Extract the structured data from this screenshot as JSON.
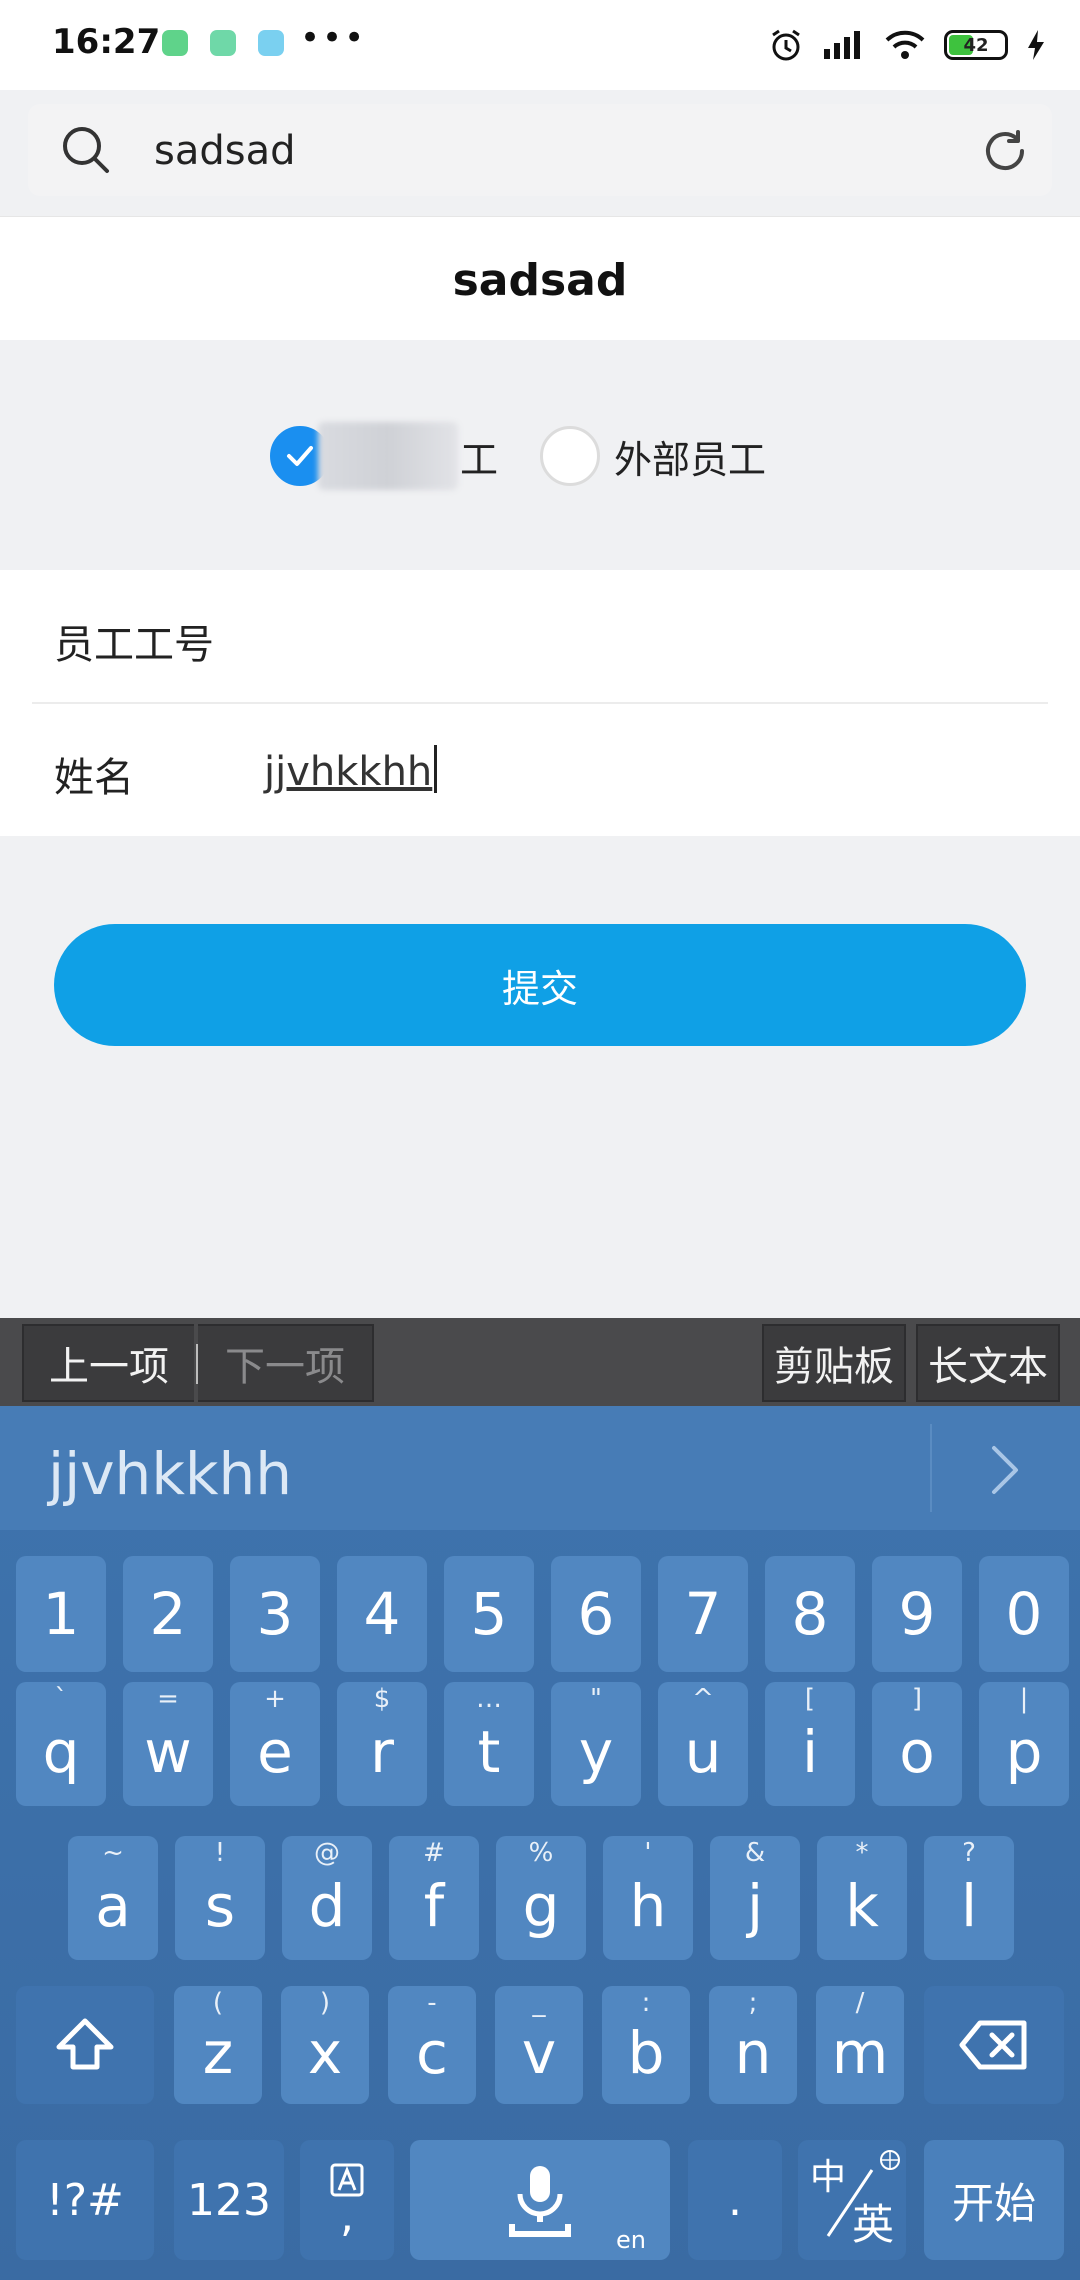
{
  "status_bar": {
    "time": "16:27",
    "battery": "42"
  },
  "search": {
    "query": "sadsad"
  },
  "page": {
    "title": "sadsad"
  },
  "employee_type": {
    "internal_label": "工",
    "external_label": "外部员工",
    "selected": "internal"
  },
  "form": {
    "employee_id_label": "员工工号",
    "employee_id_value": "",
    "name_label": "姓名",
    "name_value": "jjvhkkhh"
  },
  "submit_label": "提交",
  "accessory_bar": {
    "prev": "上一项",
    "next": "下一项",
    "clipboard": "剪贴板",
    "long_text": "长文本"
  },
  "keyboard": {
    "candidate": "jjvhkkhh",
    "number_row": [
      "1",
      "2",
      "3",
      "4",
      "5",
      "6",
      "7",
      "8",
      "9",
      "0"
    ],
    "row1": {
      "letters": [
        "q",
        "w",
        "e",
        "r",
        "t",
        "y",
        "u",
        "i",
        "o",
        "p"
      ],
      "symbols": [
        "`",
        "=",
        "+",
        "$",
        "…",
        "\"",
        "^",
        "[",
        "]",
        "|"
      ]
    },
    "row2": {
      "letters": [
        "a",
        "s",
        "d",
        "f",
        "g",
        "h",
        "j",
        "k",
        "l"
      ],
      "symbols": [
        "~",
        "!",
        "@",
        "#",
        "%",
        "'",
        "&",
        "*",
        "?"
      ]
    },
    "row3": {
      "letters": [
        "z",
        "x",
        "c",
        "v",
        "b",
        "n",
        "m"
      ],
      "symbols": [
        "(",
        ")",
        "-",
        "_",
        ":",
        ";",
        "/"
      ]
    },
    "symbols_key": "!?#",
    "num_key": "123",
    "comma_key": ",",
    "space_sub": "en",
    "period_key": ".",
    "lang_zh": "中",
    "lang_en": "英",
    "enter_key": "开始"
  },
  "colors": {
    "accent": "#0fa0e6",
    "radio_checked": "#1a8ff0",
    "keyboard_bg": "#3e73ad",
    "key_bg": "#5187c1"
  }
}
